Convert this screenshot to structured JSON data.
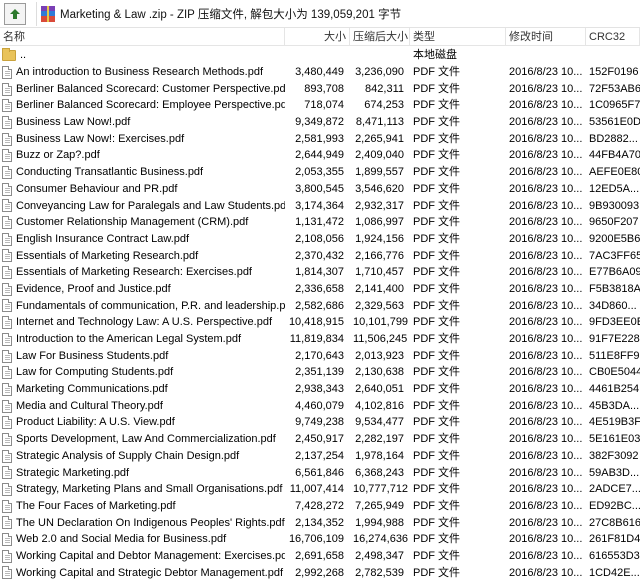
{
  "address": {
    "icon": "zip-archive-icon",
    "text": "Marketing & Law .zip - ZIP 压缩文件, 解包大小为 139,059,201 字节"
  },
  "columns": {
    "name": "名称",
    "size": "大小",
    "packed": "压缩后大小",
    "type": "类型",
    "modified": "修改时间",
    "crc": "CRC32"
  },
  "parent_row": {
    "name": "..",
    "type": "本地磁盘"
  },
  "files": [
    {
      "name": "An introduction to Business Research Methods.pdf",
      "size": "3,480,449",
      "packed": "3,236,090",
      "type": "PDF 文件",
      "modified": "2016/8/23 10...",
      "crc": "152F0196"
    },
    {
      "name": "Berliner Balanced Scorecard: Customer Perspective.pdf",
      "size": "893,708",
      "packed": "842,311",
      "type": "PDF 文件",
      "modified": "2016/8/23 10...",
      "crc": "72F53AB6"
    },
    {
      "name": "Berliner Balanced Scorecard: Employee Perspective.pdf",
      "size": "718,074",
      "packed": "674,253",
      "type": "PDF 文件",
      "modified": "2016/8/23 10...",
      "crc": "1C0965F7"
    },
    {
      "name": "Business Law Now!.pdf",
      "size": "9,349,872",
      "packed": "8,471,113",
      "type": "PDF 文件",
      "modified": "2016/8/23 10...",
      "crc": "53561E0D"
    },
    {
      "name": "Business Law Now!: Exercises.pdf",
      "size": "2,581,993",
      "packed": "2,265,941",
      "type": "PDF 文件",
      "modified": "2016/8/23 10...",
      "crc": "BD2882..."
    },
    {
      "name": "Buzz or Zap?.pdf",
      "size": "2,644,949",
      "packed": "2,409,040",
      "type": "PDF 文件",
      "modified": "2016/8/23 10...",
      "crc": "44FB4A70"
    },
    {
      "name": "Conducting Transatlantic Business.pdf",
      "size": "2,053,355",
      "packed": "1,899,557",
      "type": "PDF 文件",
      "modified": "2016/8/23 10...",
      "crc": "AEFE0E80"
    },
    {
      "name": "Consumer Behaviour and PR.pdf",
      "size": "3,800,545",
      "packed": "3,546,620",
      "type": "PDF 文件",
      "modified": "2016/8/23 10...",
      "crc": "12ED5A..."
    },
    {
      "name": "Conveyancing Law for Paralegals and Law Students.pdf",
      "size": "3,174,364",
      "packed": "2,932,317",
      "type": "PDF 文件",
      "modified": "2016/8/23 10...",
      "crc": "9B930093"
    },
    {
      "name": "Customer Relationship Management (CRM).pdf",
      "size": "1,131,472",
      "packed": "1,086,997",
      "type": "PDF 文件",
      "modified": "2016/8/23 10...",
      "crc": "9650F207"
    },
    {
      "name": "English Insurance Contract Law.pdf",
      "size": "2,108,056",
      "packed": "1,924,156",
      "type": "PDF 文件",
      "modified": "2016/8/23 10...",
      "crc": "9200E5B6"
    },
    {
      "name": "Essentials of Marketing Research.pdf",
      "size": "2,370,432",
      "packed": "2,166,776",
      "type": "PDF 文件",
      "modified": "2016/8/23 10...",
      "crc": "7AC3FF65"
    },
    {
      "name": "Essentials of Marketing Research: Exercises.pdf",
      "size": "1,814,307",
      "packed": "1,710,457",
      "type": "PDF 文件",
      "modified": "2016/8/23 10...",
      "crc": "E77B6A09"
    },
    {
      "name": "Evidence, Proof and Justice.pdf",
      "size": "2,336,658",
      "packed": "2,141,400",
      "type": "PDF 文件",
      "modified": "2016/8/23 10...",
      "crc": "F5B3818A"
    },
    {
      "name": "Fundamentals of communication, P.R. and leadership.pdf",
      "size": "2,582,686",
      "packed": "2,329,563",
      "type": "PDF 文件",
      "modified": "2016/8/23 10...",
      "crc": "34D860..."
    },
    {
      "name": "Internet and Technology Law: A U.S. Perspective.pdf",
      "size": "10,418,915",
      "packed": "10,101,799",
      "type": "PDF 文件",
      "modified": "2016/8/23 10...",
      "crc": "9FD3EE0E"
    },
    {
      "name": "Introduction to the American Legal System.pdf",
      "size": "11,819,834",
      "packed": "11,506,245",
      "type": "PDF 文件",
      "modified": "2016/8/23 10...",
      "crc": "91F7E228"
    },
    {
      "name": "Law For Business Students.pdf",
      "size": "2,170,643",
      "packed": "2,013,923",
      "type": "PDF 文件",
      "modified": "2016/8/23 10...",
      "crc": "511E8FF9"
    },
    {
      "name": "Law for Computing Students.pdf",
      "size": "2,351,139",
      "packed": "2,130,638",
      "type": "PDF 文件",
      "modified": "2016/8/23 10...",
      "crc": "CB0E5044"
    },
    {
      "name": "Marketing Communications.pdf",
      "size": "2,938,343",
      "packed": "2,640,051",
      "type": "PDF 文件",
      "modified": "2016/8/23 10...",
      "crc": "4461B254"
    },
    {
      "name": "Media and Cultural Theory.pdf",
      "size": "4,460,079",
      "packed": "4,102,816",
      "type": "PDF 文件",
      "modified": "2016/8/23 10...",
      "crc": "45B3DA..."
    },
    {
      "name": "Product Liability: A U.S. View.pdf",
      "size": "9,749,238",
      "packed": "9,534,477",
      "type": "PDF 文件",
      "modified": "2016/8/23 10...",
      "crc": "4E519B3F"
    },
    {
      "name": "Sports Development, Law And Commercialization.pdf",
      "size": "2,450,917",
      "packed": "2,282,197",
      "type": "PDF 文件",
      "modified": "2016/8/23 10...",
      "crc": "5E161E03"
    },
    {
      "name": "Strategic Analysis of Supply Chain Design.pdf",
      "size": "2,137,254",
      "packed": "1,978,164",
      "type": "PDF 文件",
      "modified": "2016/8/23 10...",
      "crc": "382F3092"
    },
    {
      "name": "Strategic Marketing.pdf",
      "size": "6,561,846",
      "packed": "6,368,243",
      "type": "PDF 文件",
      "modified": "2016/8/23 10...",
      "crc": "59AB3D..."
    },
    {
      "name": "Strategy, Marketing Plans and Small Organisations.pdf",
      "size": "11,007,414",
      "packed": "10,777,712",
      "type": "PDF 文件",
      "modified": "2016/8/23 10...",
      "crc": "2ADCE7..."
    },
    {
      "name": "The Four Faces of Marketing.pdf",
      "size": "7,428,272",
      "packed": "7,265,949",
      "type": "PDF 文件",
      "modified": "2016/8/23 10...",
      "crc": "ED92BC..."
    },
    {
      "name": "The UN Declaration On Indigenous Peoples' Rights.pdf",
      "size": "2,134,352",
      "packed": "1,994,988",
      "type": "PDF 文件",
      "modified": "2016/8/23 10...",
      "crc": "27C8B616"
    },
    {
      "name": "Web 2.0 and Social Media for Business.pdf",
      "size": "16,706,109",
      "packed": "16,274,636",
      "type": "PDF 文件",
      "modified": "2016/8/23 10...",
      "crc": "261F81D4"
    },
    {
      "name": "Working Capital and Debtor Management: Exercises.pdf",
      "size": "2,691,658",
      "packed": "2,498,347",
      "type": "PDF 文件",
      "modified": "2016/8/23 10...",
      "crc": "616553D3"
    },
    {
      "name": "Working Capital and Strategic Debtor Management.pdf",
      "size": "2,992,268",
      "packed": "2,782,539",
      "type": "PDF 文件",
      "modified": "2016/8/23 10...",
      "crc": "1CD42E..."
    }
  ]
}
